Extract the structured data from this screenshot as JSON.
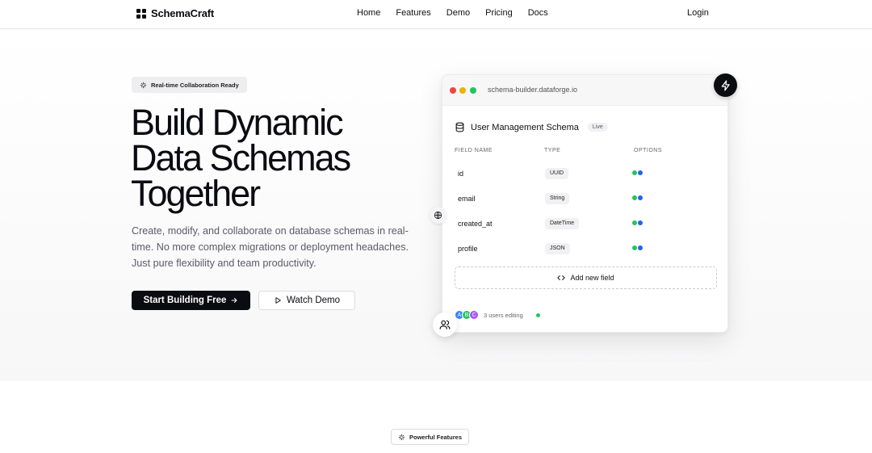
{
  "header": {
    "brand": "SchemaCraft",
    "nav": [
      "Home",
      "Features",
      "Demo",
      "Pricing",
      "Docs"
    ],
    "login": "Login"
  },
  "hero": {
    "badge": "Real-time Collaboration Ready",
    "title_lines": [
      "Build Dynamic",
      "Data Schemas",
      "Together"
    ],
    "description_lines": [
      "Create, modify, and collaborate on database schemas in real-",
      "time. No more complex migrations or deployment headaches.",
      "Just pure flexibility and team productivity."
    ],
    "primary_button": "Start Building Free",
    "secondary_button": "Watch Demo"
  },
  "window": {
    "url": "schema-builder.dataforge.io",
    "schema_title": "User Management Schema",
    "status": "Live",
    "columns": [
      "FIELD NAME",
      "TYPE",
      "OPTIONS"
    ],
    "fields": [
      {
        "name": "id",
        "type": "UUID"
      },
      {
        "name": "email",
        "type": "String"
      },
      {
        "name": "created_at",
        "type": "DateTime"
      },
      {
        "name": "profile",
        "type": "JSON"
      }
    ],
    "add_field": "Add new field",
    "avatars": [
      "A",
      "B",
      "C"
    ],
    "editing_text": "3 users editing"
  },
  "colors": {
    "accent_dark": "#0b0b12",
    "option_green": "#22c55e",
    "option_blue": "#2563eb",
    "avatar_a": "#3b82f6",
    "avatar_b": "#22c55e",
    "avatar_c": "#a855f7"
  },
  "icons": {
    "badge": "sparkles-icon",
    "primary_button": "arrow-right-icon",
    "secondary_button": "play-icon",
    "schema": "database-icon",
    "add_field": "code-icon",
    "fab_top": "bolt-icon",
    "fab_mid": "globe-icon",
    "fab_bottom": "users-icon"
  },
  "features_section": {
    "badge": "Powerful Features"
  }
}
